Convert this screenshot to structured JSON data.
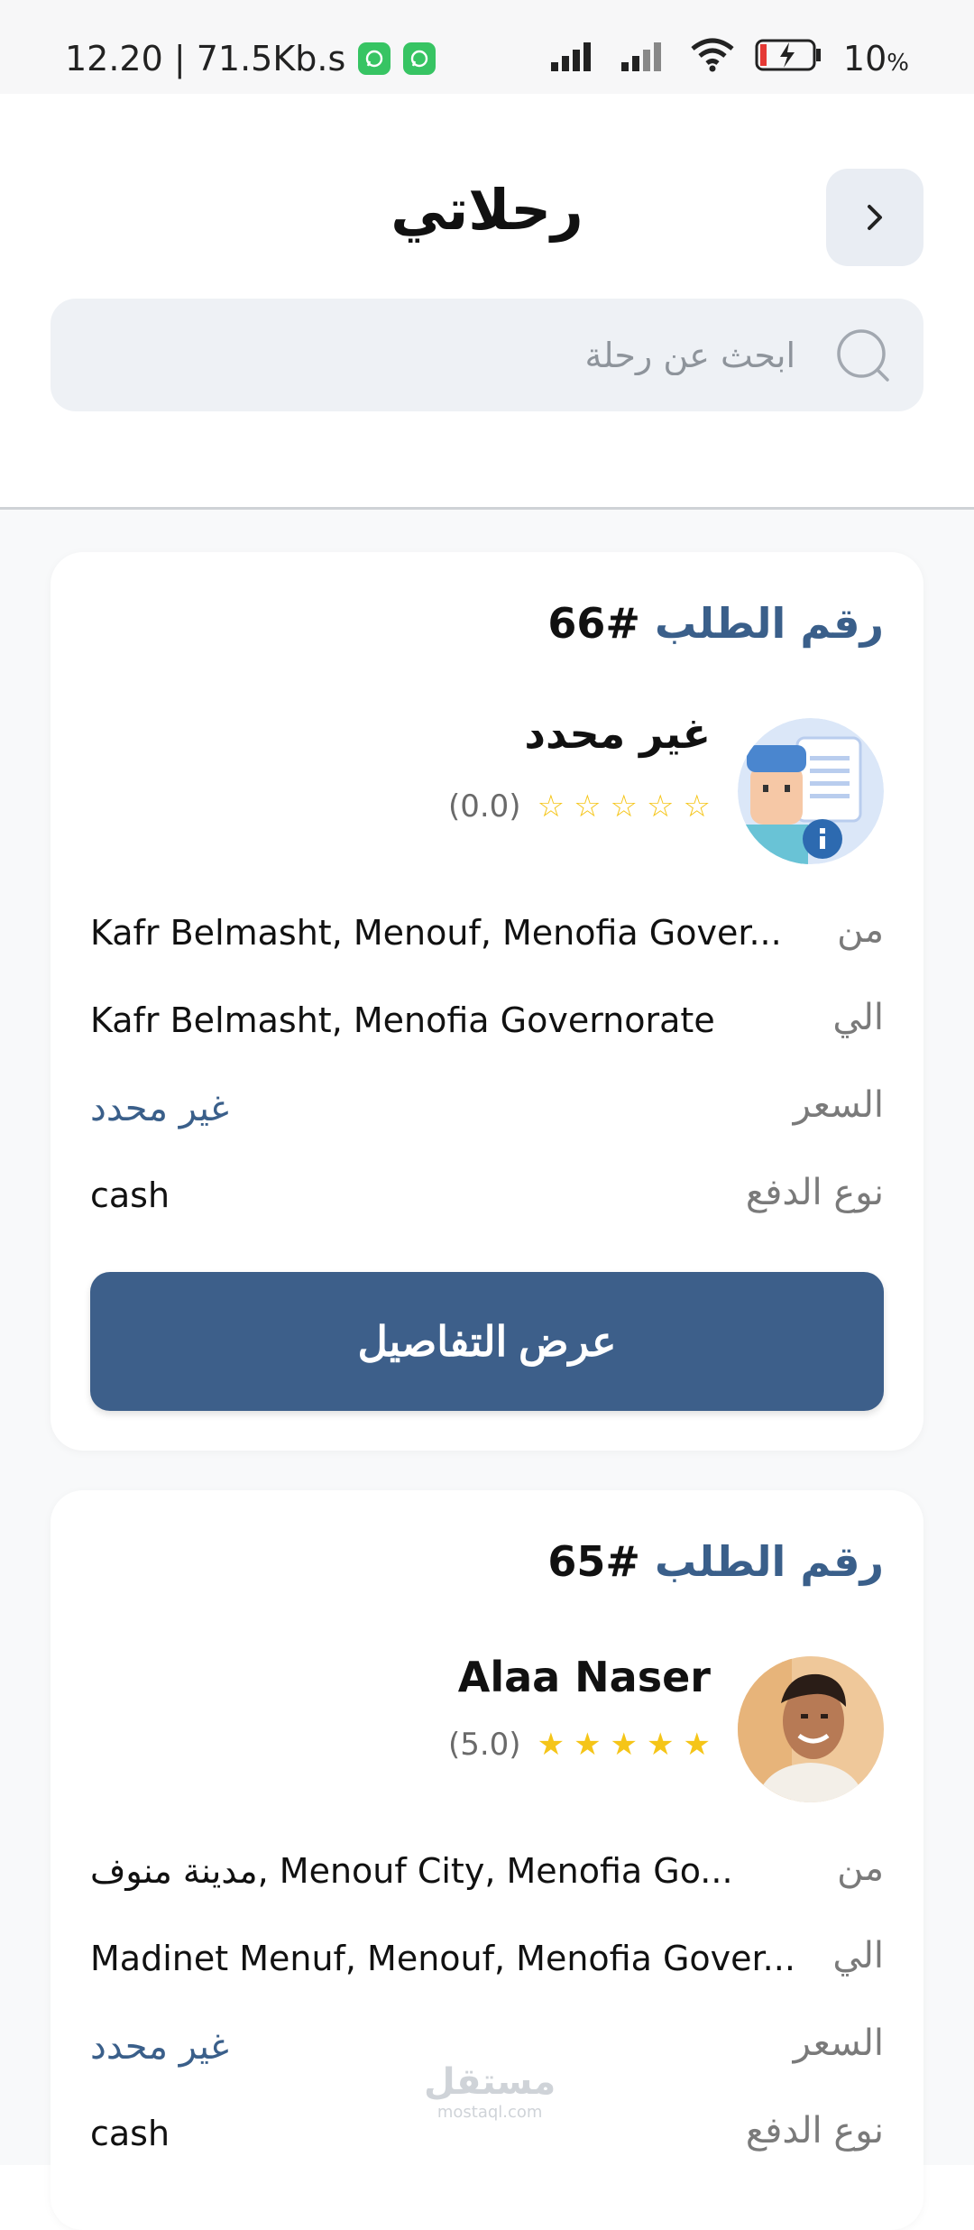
{
  "status_bar": {
    "left_text": "12.20 | 71.5Kb.s",
    "battery": "10",
    "battery_unit": "%"
  },
  "header": {
    "title": "رحلاتي",
    "back_icon": "chevron-right-icon"
  },
  "search": {
    "placeholder": "ابحث عن رحلة",
    "value": ""
  },
  "trips": [
    {
      "order_label": "رقم الطلب",
      "order_number": "#66",
      "driver_name": "غير محدد",
      "rating": "(0.0)",
      "stars_filled": 0,
      "from_label": "من",
      "from_value": "Kafr Belmasht, Menouf, Menofia Gover...",
      "to_label": "الي",
      "to_value": "Kafr Belmasht, Menofia Governorate",
      "price_label": "السعر",
      "price_value": "غير محدد",
      "payment_label": "نوع الدفع",
      "payment_value": "cash",
      "details_button": "عرض التفاصيل"
    },
    {
      "order_label": "رقم الطلب",
      "order_number": "#65",
      "driver_name": "Alaa Naser",
      "rating": "(5.0)",
      "stars_filled": 5,
      "from_label": "من",
      "from_value": "مدينة منوف, Menouf City, Menofia Go...",
      "to_label": "الي",
      "to_value": "Madinet Menuf, Menouf, Menofia Gover...",
      "price_label": "السعر",
      "price_value": "غير محدد",
      "payment_label": "نوع الدفع",
      "payment_value": "cash"
    }
  ],
  "watermark": {
    "arabic": "مستقل",
    "latin": "mostaql.com"
  },
  "colors": {
    "accent": "#3d5f8a",
    "label_blue": "#3a5f8a",
    "star": "#f5c518",
    "search_bg": "#eef1f5"
  }
}
